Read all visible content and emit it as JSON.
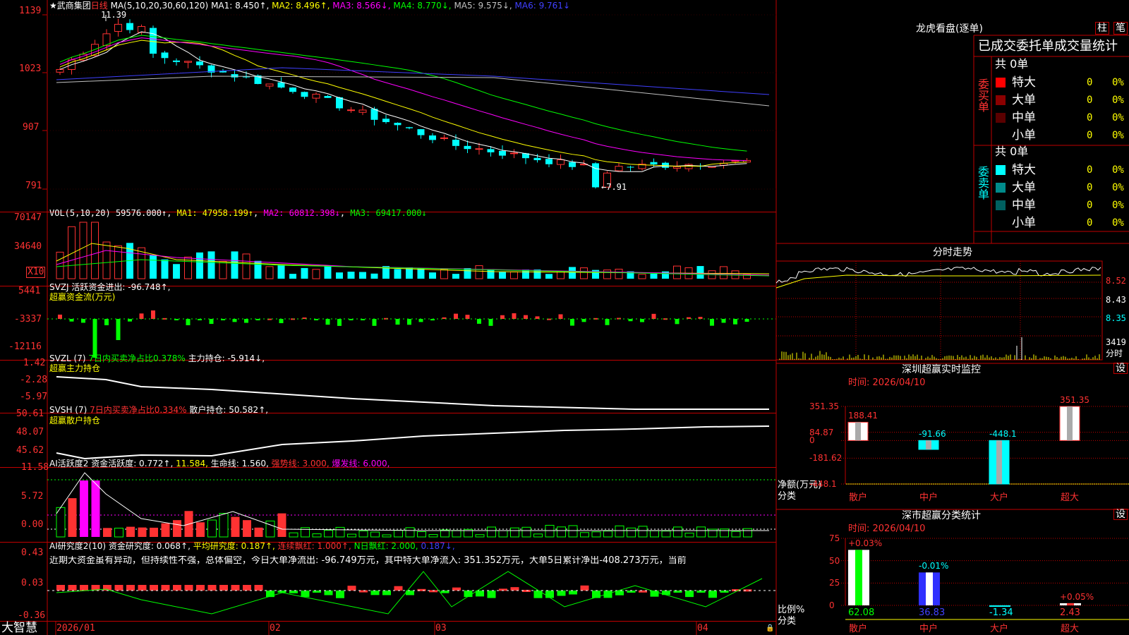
{
  "colors": {
    "up": "#ff3232",
    "down": "#00ffff",
    "frame": "#c00000",
    "grid": "#7a0000",
    "white": "#ffffff",
    "yellow": "#ffff00",
    "magenta": "#ff00ff",
    "green": "#00ff00",
    "blue": "#4040ff",
    "gray": "#c0c0c0"
  },
  "chart_header": {
    "title": "★武商集团",
    "period": "日线",
    "ma_prefix": "MA(5,10,20,30,60,120)",
    "ma": [
      {
        "name": "MA1:",
        "value": "8.450↑",
        "color": "#ffffff"
      },
      {
        "name": "MA2:",
        "value": "8.496↑",
        "color": "#ffff00"
      },
      {
        "name": "MA3:",
        "value": "8.566↓",
        "color": "#ff00ff"
      },
      {
        "name": "MA4:",
        "value": "8.770↓",
        "color": "#00ff00"
      },
      {
        "name": "MA5:",
        "value": "9.575↓",
        "color": "#c0c0c0"
      },
      {
        "name": "MA6:",
        "value": "9.761↓",
        "color": "#4040ff"
      }
    ]
  },
  "price_axis": [
    "1139",
    "1023",
    "907",
    "791"
  ],
  "price_high_label": "11.39",
  "price_low_label": "←7.91",
  "vol": {
    "title": "VOL(5,10,20)",
    "value": "59576.000↑",
    "ma1": "MA1: 47958.199↑",
    "ma2": "MA2: 60812.398↓",
    "ma3": "MA3: 69417.000↓",
    "axis": [
      "70147",
      "34640"
    ],
    "unit": "X10"
  },
  "svzj": {
    "title": "SVZJ  活跃资金进出: -96.748↑,",
    "sub": "超赢资金流(万元)",
    "axis": [
      "5441",
      "-3337",
      "-12116"
    ]
  },
  "svzl": {
    "title": "SVZL (7)",
    "t2": "7日内买卖净占比0.378%",
    "t3": "主力持仓: -5.914↓,",
    "sub": "超赢主力持仓",
    "axis": [
      "1.42",
      "-2.28",
      "-5.97"
    ]
  },
  "svsh": {
    "title": "SVSH (7)",
    "t2": "7日内买卖净占比0.334%",
    "t3": "散户持仓: 50.582↑,",
    "sub": "超赢散户持仓",
    "axis": [
      "50.61",
      "48.07",
      "45.62"
    ]
  },
  "ai1": {
    "title": "AI活跃度2 资金活跃度: 0.772↑,",
    "v2": "11.584,",
    "v3": "生命线: 1.560,",
    "v4": "强势线: 3.000,",
    "v5": "爆发线: 6.000,",
    "axis": [
      "11.58",
      "5.72",
      "0.00"
    ]
  },
  "ai2": {
    "title": "AI研究度2(10) 资金研究度: 0.068↑,",
    "v2": "平均研究度: 0.187↑,",
    "v3": "连续飘红: 1.000↑,",
    "v4": "N日飘红: 2.000,",
    "v5": "0.187↓,",
    "note": "近期大资金虽有异动，但持续性不强，总体偏空，今日大单净流出: -96.749万元，其中特大单净流入: 351.352万元，大单5日累计净出-408.273万元，当前",
    "axis": [
      "0.43",
      "0.03",
      "-0.36"
    ]
  },
  "date_axis": [
    "2026/01",
    "02",
    "03",
    "04"
  ],
  "brand": "大智慧",
  "right": {
    "lh_title": "龙虎看盘(逐单)",
    "btn_zhu": "柱",
    "btn_bi": "笔",
    "deal_title": "已成交委托单成交量统计",
    "buy": {
      "side": "委买单",
      "total": "共 0单",
      "rows": [
        {
          "label": "特大",
          "v": "0",
          "p": "0%",
          "c": "#ff0000"
        },
        {
          "label": "大单",
          "v": "0",
          "p": "0%",
          "c": "#8b0000"
        },
        {
          "label": "中单",
          "v": "0",
          "p": "0%",
          "c": "#5a0000"
        },
        {
          "label": "小单",
          "v": "0",
          "p": "0%",
          "c": ""
        }
      ]
    },
    "sell": {
      "side": "委卖单",
      "total": "共 0单",
      "rows": [
        {
          "label": "特大",
          "v": "0",
          "p": "0%",
          "c": "#00ffff"
        },
        {
          "label": "大单",
          "v": "0",
          "p": "0%",
          "c": "#008b8b"
        },
        {
          "label": "中单",
          "v": "0",
          "p": "0%",
          "c": "#006060"
        },
        {
          "label": "小单",
          "v": "0",
          "p": "0%",
          "c": ""
        }
      ]
    },
    "fs": {
      "title": "分时走势",
      "axis": [
        "8.52",
        "8.43",
        "8.35"
      ],
      "vol": "3419",
      "vol_unit": "分时"
    },
    "sz": {
      "title": "深圳超赢实时监控",
      "set": "设",
      "time": "时间: 2026/04/10",
      "axis": [
        "351.35",
        "84.87",
        "0",
        "-181.62",
        "-448.1"
      ],
      "ylabel": "净额(万元)",
      "xlabel": "分类"
    },
    "ss": {
      "title": "深市超赢分类统计",
      "set": "设",
      "time": "时间: 2026/04/10",
      "axis": [
        "75",
        "50",
        "25",
        "0"
      ],
      "ylabel": "比例%",
      "xlabel": "分类"
    }
  },
  "chart_data": [
    {
      "type": "bar",
      "name": "sz-monitor",
      "categories": [
        "散户",
        "中户",
        "大户",
        "超大"
      ],
      "values": [
        188.41,
        -91.66,
        -448.1,
        351.35
      ],
      "labels": [
        "188.41",
        "-91.66",
        "-448.1",
        "351.35"
      ],
      "ylim": [
        -448.1,
        351.35
      ]
    },
    {
      "type": "bar",
      "name": "ss-stats",
      "categories": [
        "散户",
        "中户",
        "大户",
        "超大"
      ],
      "values": [
        62.08,
        36.83,
        -1.34,
        2.43
      ],
      "top_labels": [
        "+0.03%",
        "-0.01%",
        "",
        "+0.05%"
      ],
      "bottom_labels": [
        "62.08",
        "36.83",
        "-1.34",
        "2.43"
      ],
      "ylim": [
        0,
        75
      ]
    }
  ]
}
